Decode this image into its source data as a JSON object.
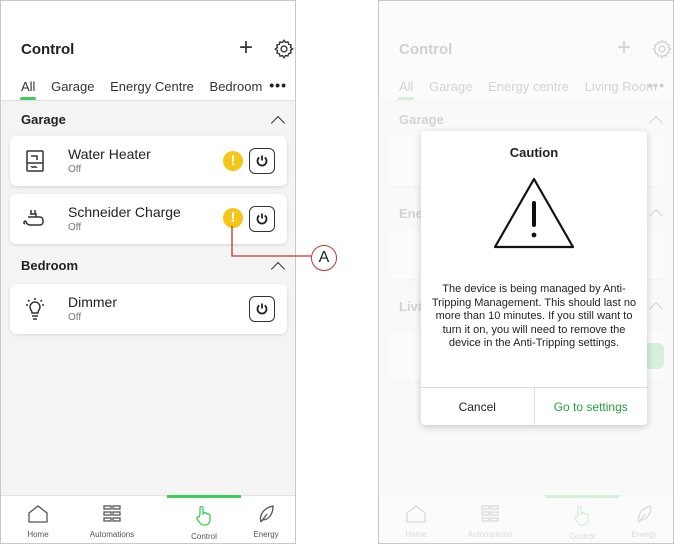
{
  "left_screen": {
    "title": "Control",
    "tabs": [
      "All",
      "Garage",
      "Energy Centre",
      "Bedroom"
    ],
    "more_label": "•••",
    "sections": [
      {
        "name": "Garage",
        "devices": [
          {
            "name": "Water Heater",
            "state": "Off",
            "icon": "water-heater-icon",
            "warning": true
          },
          {
            "name": "Schneider Charge",
            "state": "Off",
            "icon": "ev-charger-icon",
            "warning": true
          }
        ]
      },
      {
        "name": "Bedroom",
        "devices": [
          {
            "name": "Dimmer",
            "state": "Off",
            "icon": "bulb-icon",
            "warning": false
          }
        ]
      }
    ],
    "warning_symbol": "!",
    "callout_label": "A"
  },
  "right_screen": {
    "title": "Control",
    "tabs": [
      "All",
      "Garage",
      "Energy centre",
      "Living Room"
    ],
    "more_label": "•••",
    "bg_sections": [
      "Garage",
      "Ene",
      "Livi"
    ],
    "dialog": {
      "title": "Caution",
      "message": "The device is being managed by Anti-Tripping Management. This should last no more than 10 minutes. If you still want to turn it on, you will need to remove the device in the Anti-Tripping settings.",
      "cancel_label": "Cancel",
      "confirm_label": "Go to settings"
    }
  },
  "nav": [
    {
      "label": "Home",
      "icon": "home-icon"
    },
    {
      "label": "Automations",
      "icon": "automations-icon"
    },
    {
      "label": "Control",
      "icon": "control-hand-icon",
      "active": true
    },
    {
      "label": "Energy",
      "icon": "energy-leaf-icon"
    }
  ],
  "colors": {
    "accent": "#3dcd58",
    "warning": "#f5c518",
    "callout": "#c0392b"
  }
}
